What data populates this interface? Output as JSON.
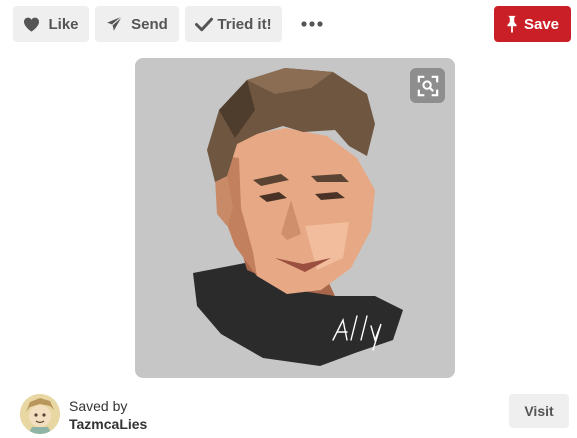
{
  "toolbar": {
    "like_label": "Like",
    "send_label": "Send",
    "tried_label": "Tried it!",
    "save_label": "Save",
    "icons": {
      "like": "heart-icon",
      "send": "paper-plane-icon",
      "tried": "checkmark-icon",
      "more": "more-dots-icon",
      "save": "pushpin-icon"
    }
  },
  "pin": {
    "image_icon": "expand-magnify-icon",
    "signature": "Ally"
  },
  "footer": {
    "saved_by_label": "Saved by",
    "user_name": "TazmcaLies",
    "visit_label": "Visit"
  },
  "colors": {
    "save_red": "#cb1f27",
    "button_gray": "#efefef",
    "text_gray": "#555555",
    "image_background": "#c6c6c6"
  }
}
